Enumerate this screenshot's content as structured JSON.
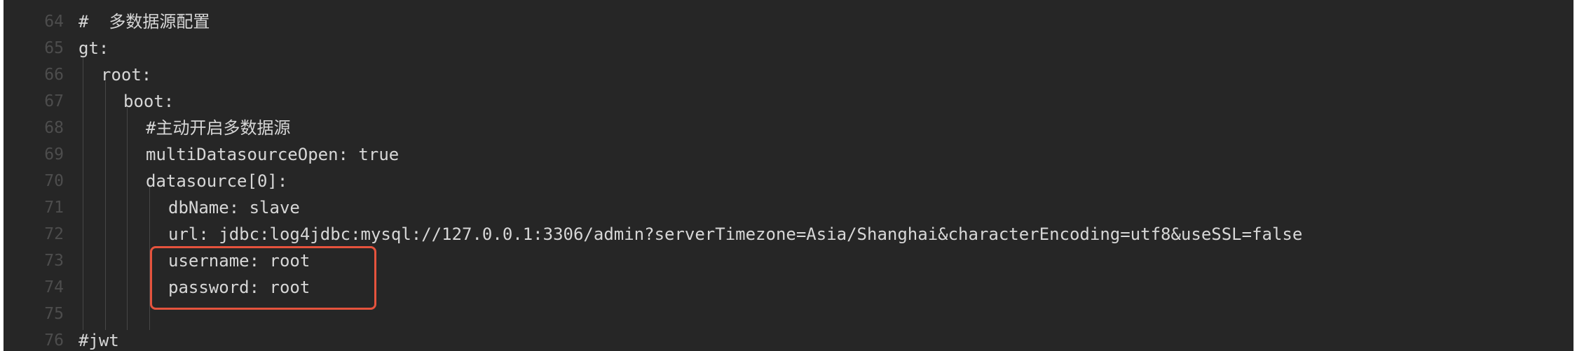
{
  "editor": {
    "lines": [
      {
        "number": "64",
        "text": "#  多数据源配置"
      },
      {
        "number": "65",
        "text": "gt:"
      },
      {
        "number": "66",
        "text": "root:"
      },
      {
        "number": "67",
        "text": "boot:"
      },
      {
        "number": "68",
        "text": "#主动开启多数据源"
      },
      {
        "number": "69",
        "text": "multiDatasourceOpen: true"
      },
      {
        "number": "70",
        "text": "datasource[0]:"
      },
      {
        "number": "71",
        "text": "dbName: slave"
      },
      {
        "number": "72",
        "text": "url: jdbc:log4jdbc:mysql://127.0.0.1:3306/admin?serverTimezone=Asia/Shanghai&characterEncoding=utf8&useSSL=false"
      },
      {
        "number": "73",
        "text": "username: root"
      },
      {
        "number": "74",
        "text": "password: root"
      },
      {
        "number": "75",
        "text": ""
      },
      {
        "number": "76",
        "text": "#jwt"
      }
    ]
  },
  "colors": {
    "background": "#262626",
    "line_number": "#4d4d4d",
    "text": "#d7d7d7",
    "highlight_border": "#e5533d"
  }
}
